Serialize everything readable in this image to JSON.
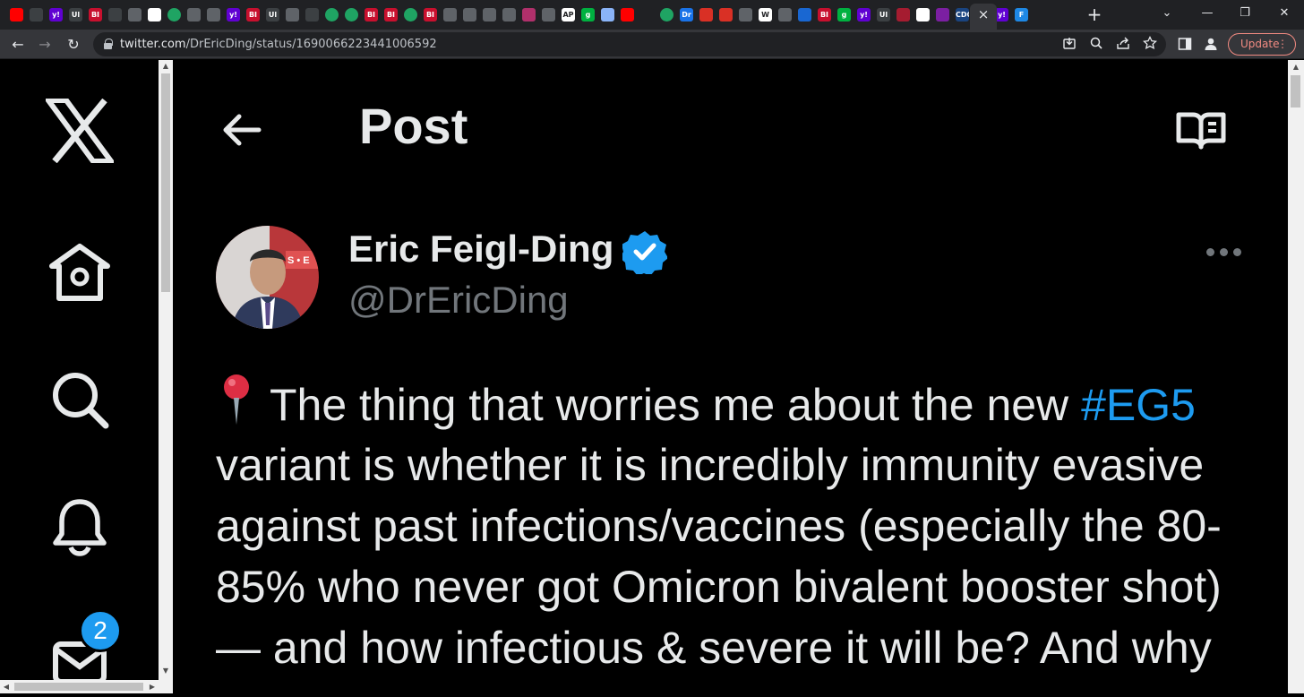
{
  "browser": {
    "tabs_favicons": [
      "youtube-icon",
      "globe-icon",
      "yahoo-icon",
      "text-icon",
      "bi-icon",
      "globe-icon",
      "bookmark-icon",
      "app-icon",
      "play-icon",
      "chrome-icon",
      "bookmark-icon",
      "yahoo-icon",
      "bi-icon",
      "text-icon",
      "chrome-icon",
      "globe-icon",
      "play-icon",
      "play-icon",
      "bi-icon",
      "bi-icon",
      "play-icon",
      "bi-icon",
      "bookmark-icon",
      "bookmark-icon",
      "bookmark-icon",
      "bookmark-icon",
      "starburst-icon",
      "chrome-icon",
      "news-icon",
      "g-icon",
      "person-icon",
      "youtube-icon",
      "cat-icon",
      "play-icon",
      "dr-icon",
      "pin-icon",
      "pin-icon",
      "bookmark-icon",
      "w-icon",
      "bookmark-icon",
      "cube-icon",
      "bi-icon",
      "g-icon",
      "yahoo-icon",
      "text-icon",
      "crest-icon",
      "plus-icon",
      "purple-icon",
      "cdc-icon",
      "youtube-icon",
      "yahoo-icon",
      "f-icon"
    ],
    "tab_labels": [
      "",
      "",
      "y!",
      "Ul",
      "BI",
      "",
      "",
      "",
      "",
      "",
      "",
      "y!",
      "BI",
      "Ul",
      "",
      "",
      "",
      "",
      "BI",
      "BI",
      "",
      "BI",
      "",
      "",
      "",
      "",
      "",
      "",
      "AP",
      "g",
      "",
      "",
      "",
      "",
      "Dr",
      "",
      "",
      "",
      "W",
      "",
      "",
      "BI",
      "g",
      "y!",
      "Ul",
      "",
      "",
      "",
      "CDC",
      "",
      "y!",
      "F"
    ],
    "tab_close": "×",
    "new_tab": "+",
    "window_controls": {
      "dropdown": "⌄",
      "minimize": "—",
      "restore": "❐",
      "close": "✕"
    },
    "nav": {
      "back": "←",
      "forward": "→",
      "reload": "↻"
    },
    "url_host": "twitter.com",
    "url_path": "/DrEricDing/status/1690066223441006592",
    "update_label": "Update",
    "update_menu": "⋮"
  },
  "sidebar": {
    "logo": "x-logo-icon",
    "items": [
      {
        "name": "home",
        "icon": "home-icon"
      },
      {
        "name": "explore",
        "icon": "search-icon"
      },
      {
        "name": "notifications",
        "icon": "bell-icon"
      },
      {
        "name": "messages",
        "icon": "envelope-icon"
      }
    ],
    "messages_badge": "2"
  },
  "header": {
    "title": "Post"
  },
  "post": {
    "author_name": "Eric Feigl-Ding",
    "handle": "@DrEricDing",
    "verified": true,
    "text_lines": [
      {
        "before": "The thing that worries me about the new ",
        "hashtag": "#EG5"
      },
      {
        "text": "variant is whether it is incredibly immunity evasive"
      },
      {
        "text": "against past infections/vaccines (especially the 80-"
      },
      {
        "text": "85% who never got Omicron bivalent booster shot)"
      },
      {
        "text": "— and how infectious & severe it will be? And why"
      }
    ]
  },
  "colors": {
    "background": "#000000",
    "text": "#e7e9ea",
    "secondary_text": "#71767b",
    "accent": "#1d9bf0",
    "update_accent": "#f28b82"
  }
}
